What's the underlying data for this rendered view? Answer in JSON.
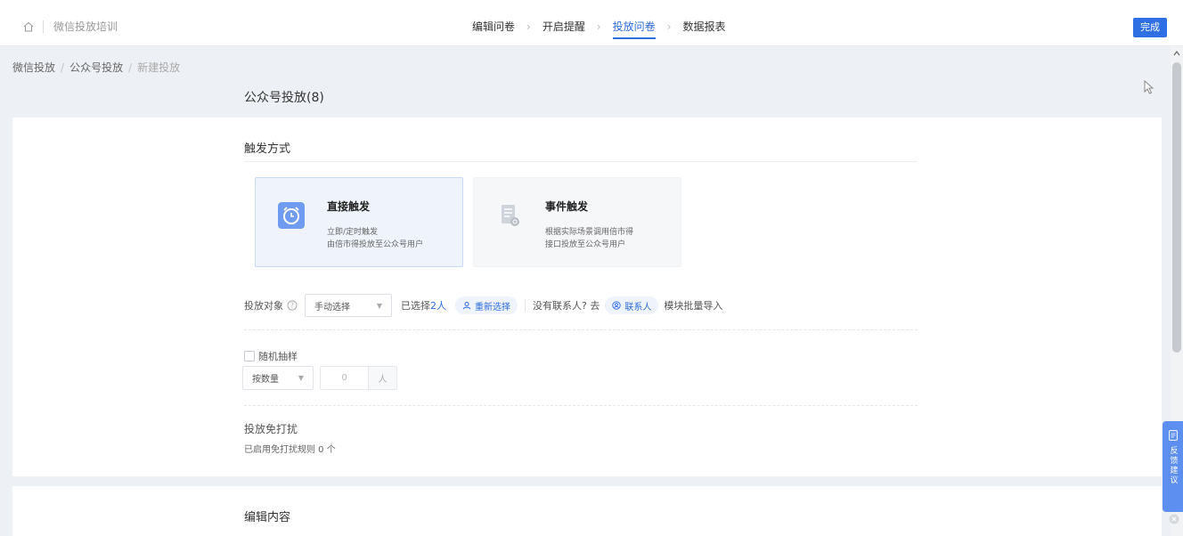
{
  "header": {
    "app_title": "微信投放培训",
    "steps": [
      {
        "label": "编辑问卷",
        "active": false
      },
      {
        "label": "开启提醒",
        "active": false
      },
      {
        "label": "投放问卷",
        "active": true
      },
      {
        "label": "数据报表",
        "active": false
      }
    ],
    "done_label": "完成"
  },
  "breadcrumb": [
    "微信投放",
    "公众号投放",
    "新建投放"
  ],
  "page_title": "公众号投放(8)",
  "trigger_section": {
    "title": "触发方式",
    "options": [
      {
        "name": "直接触发",
        "desc1": "立即/定时触发",
        "desc2": "由倍市得投放至公众号用户",
        "selected": true
      },
      {
        "name": "事件触发",
        "desc1": "根据实际场景调用倍市得",
        "desc2": "接口投放至公众号用户",
        "selected": false
      }
    ]
  },
  "audience": {
    "label": "投放对象",
    "select_value": "手动选择",
    "selected_prefix": "已选择",
    "selected_count": "2人",
    "reselect_label": "重新选择",
    "no_contact_text": "没有联系人? 去",
    "contacts_label": "联系人",
    "import_text": "模块批量导入"
  },
  "sampling": {
    "checkbox_label": "随机抽样",
    "mode": "按数量",
    "value": "0",
    "unit": "人"
  },
  "dnd": {
    "title": "投放免打扰",
    "sub": "已启用免打扰规则 0 个"
  },
  "content_section": {
    "title": "编辑内容"
  },
  "feedback": {
    "label": "反馈建议"
  },
  "colors": {
    "accent": "#2d6cdf",
    "button": "#2f6fe4",
    "feedback": "#5d8ff0"
  }
}
